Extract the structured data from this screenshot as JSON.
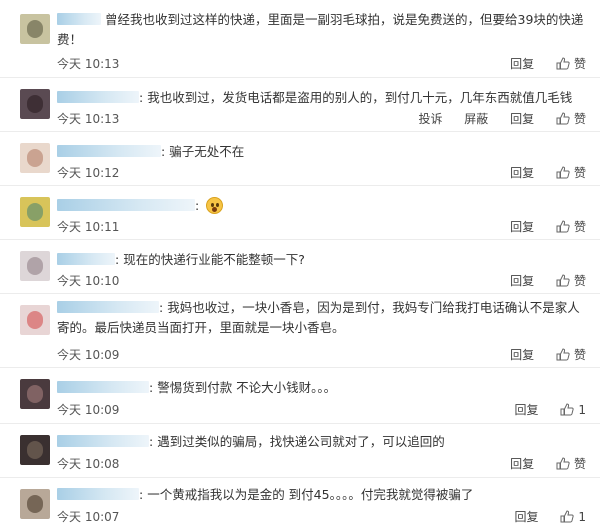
{
  "comments": [
    {
      "prefix": "",
      "text": "曾经我也收到过这样的快递，里面是一副羽毛球拍，说是免费送的，但要给39块的快递费！",
      "time": "今天 10:13",
      "actions": [
        "回复"
      ],
      "like": "赞",
      "avatar": [
        "#c8c3a0",
        "#7c7a5e"
      ]
    },
    {
      "prefix": ":",
      "text": "我也收到过，发货电话都是盗用的别人的，到付几十元，几年东西就值几毛钱",
      "time": "今天 10:13",
      "actions": [
        "投诉",
        "屏蔽",
        "回复"
      ],
      "like": "赞",
      "avatar": [
        "#5a4a52",
        "#3a2a30"
      ]
    },
    {
      "prefix": ":",
      "text": "骗子无处不在",
      "time": "今天 10:12",
      "actions": [
        "回复"
      ],
      "like": "赞",
      "avatar": [
        "#e9d8cc",
        "#c49a86"
      ]
    },
    {
      "prefix": ":",
      "text": "",
      "time": "今天 10:11",
      "actions": [
        "回复"
      ],
      "like": "赞",
      "avatar": [
        "#d8c45a",
        "#7a9a6a"
      ]
    },
    {
      "prefix": ":",
      "text": "现在的快递行业能不能整顿一下?",
      "time": "今天 10:10",
      "actions": [
        "回复"
      ],
      "like": "赞",
      "avatar": [
        "#ddd6d8",
        "#a89aa0"
      ]
    },
    {
      "prefix": ":",
      "text": "我妈也收过，一块小香皂，因为是到付，我妈专门给我打电话确认不是家人寄的。最后快递员当面打开，里面就是一块小香皂。",
      "time": "今天 10:09",
      "actions": [
        "回复"
      ],
      "like": "赞",
      "avatar": [
        "#e8d5d5",
        "#d97878"
      ]
    },
    {
      "prefix": ":",
      "text": "警惕货到付款 不论大小钱财。。。",
      "time": "今天 10:09",
      "actions": [
        "回复"
      ],
      "like": "1",
      "avatar": [
        "#4a3a3e",
        "#8a6a6a"
      ]
    },
    {
      "prefix": ":",
      "text": "遇到过类似的骗局，找快递公司就对了，可以追回的",
      "time": "今天 10:08",
      "actions": [
        "回复"
      ],
      "like": "赞",
      "avatar": [
        "#3a3030",
        "#6a5a50"
      ]
    },
    {
      "prefix": ":",
      "text": "一个黄戒指我以为是金的 到付45。。。。付完我就觉得被骗了",
      "time": "今天 10:07",
      "actions": [
        "回复"
      ],
      "like": "1",
      "avatar": [
        "#b8a898",
        "#6a5a4a"
      ]
    }
  ]
}
